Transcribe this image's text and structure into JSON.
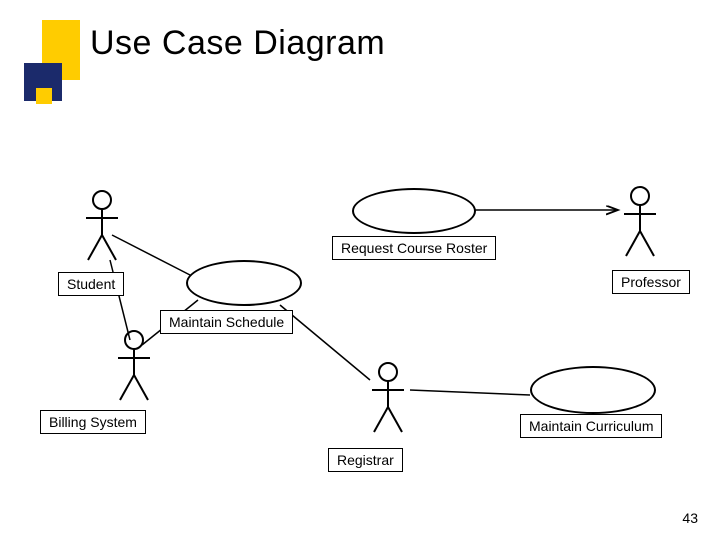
{
  "title": "Use Case Diagram",
  "slide_number": "43",
  "actors": {
    "student": "Student",
    "professor": "Professor",
    "billing_system": "Billing System",
    "registrar": "Registrar"
  },
  "usecases": {
    "request_course_roster": "Request Course Roster",
    "maintain_schedule": "Maintain Schedule",
    "maintain_curriculum": "Maintain Curriculum"
  }
}
